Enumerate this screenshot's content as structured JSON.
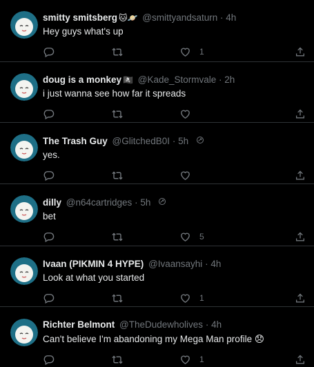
{
  "tweets": [
    {
      "name": "smitty smitsberg",
      "name_emoji": "🐱🪐",
      "handle": "@smittyandsaturn",
      "separator": "·",
      "time": "4h",
      "text": "Hey guys what's up",
      "likes": "1",
      "grok_icon": ""
    },
    {
      "name": "doug is a monkey",
      "name_emoji": "🏴‍☠️",
      "handle": "@Kade_Stormvale",
      "separator": "·",
      "time": "2h",
      "text": "i just wanna see how far it spreads",
      "likes": "",
      "grok_icon": ""
    },
    {
      "name": "The Trash Guy",
      "name_emoji": "",
      "handle": "@GlitchedB0I",
      "separator": "·",
      "time": "5h",
      "text": "yes.",
      "likes": "",
      "grok_icon": "grok-icon"
    },
    {
      "name": "dilly",
      "name_emoji": "",
      "handle": "@n64cartridges",
      "separator": "·",
      "time": "5h",
      "text": "bet",
      "likes": "5",
      "grok_icon": "grok-icon"
    },
    {
      "name": "Ivaan (PIKMIN 4 HYPE)",
      "name_emoji": "",
      "handle": "@Ivaansayhi",
      "separator": "·",
      "time": "4h",
      "text": "Look at what you started",
      "likes": "1",
      "grok_icon": ""
    },
    {
      "name": "Richter Belmont",
      "name_emoji": "",
      "handle": "@TheDudewholives",
      "separator": "·",
      "time": "4h",
      "text": "Can't believe I'm abandoning my Mega Man profile 😞",
      "likes": "1",
      "grok_icon": ""
    }
  ],
  "colors": {
    "background": "#000000",
    "text_primary": "#e7e9ea",
    "text_secondary": "#71767b",
    "divider": "#2f3336",
    "avatar_bg": "#1e6f86",
    "avatar_face": "#f4f4f0"
  },
  "icons": {
    "reply": "reply-icon",
    "retweet": "retweet-icon",
    "like": "heart-icon",
    "share": "share-icon",
    "grok": "grok-icon"
  }
}
